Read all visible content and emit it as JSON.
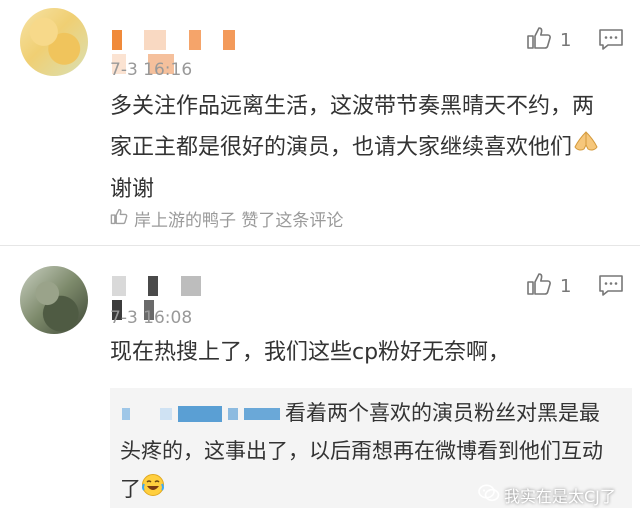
{
  "comments": [
    {
      "username": "",
      "time": "7-3 16:16",
      "likes": "1",
      "text": "多关注作品远离生活，这波带节奏黑晴天不约，两家正主都是很好的演员，也请大家继续喜欢他们",
      "text_suffix": "谢谢",
      "liked_by": "岸上游的鸭子 赞了这条评论"
    },
    {
      "username": "",
      "time": "7-3 16:08",
      "likes": "1",
      "text": "现在热搜上了，我们这些cp粉好无奈啊，",
      "quote": {
        "author": "",
        "text": "看着两个喜欢的演员粉丝对黑是最头疼的，这事出了，以后甭想再在微博看到他们互动了"
      }
    }
  ],
  "watermark": "我实在是太CJ了",
  "icons": {
    "like": "thumbs-up-icon",
    "reply": "comment-icon",
    "pray_emoji": "pray-emoji-icon",
    "laugh_emoji": "laughing-crying-emoji-icon",
    "wechat": "wechat-logo-icon"
  },
  "colors": {
    "text": "#333333",
    "meta": "#999999",
    "quote_bg": "#f4f4f4"
  }
}
